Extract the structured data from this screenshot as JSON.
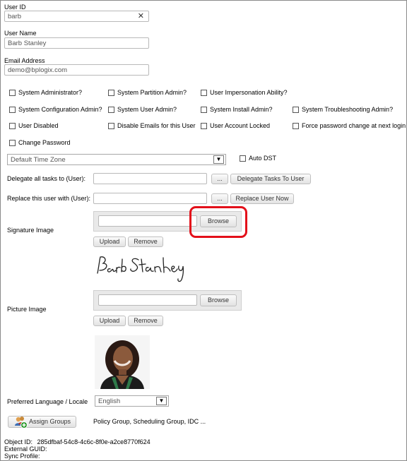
{
  "user_id": {
    "label": "User ID",
    "value": "barb"
  },
  "user_name": {
    "label": "User Name",
    "value": "Barb Stanley"
  },
  "email": {
    "label": "Email Address",
    "value": "demo@bplogix.com"
  },
  "checkboxes": {
    "sys_admin": "System Administrator?",
    "partition_admin": "System Partition Admin?",
    "impersonation": "User Impersonation Ability?",
    "config_admin": "System Configuration Admin?",
    "user_admin": "System User Admin?",
    "install_admin": "System Install Admin?",
    "troubleshooting_admin": "System Troubleshooting Admin?",
    "user_disabled": "User Disabled",
    "disable_emails": "Disable Emails for this User",
    "account_locked": "User Account Locked",
    "force_password": "Force password change at next login",
    "change_password": "Change Password"
  },
  "time_zone": {
    "value": "Default Time Zone",
    "auto_dst_label": "Auto DST"
  },
  "delegate": {
    "label": "Delegate all tasks to (User):",
    "dots": "...",
    "button": "Delegate Tasks To User"
  },
  "replace": {
    "label": "Replace this user with (User):",
    "dots": "...",
    "button": "Replace User Now"
  },
  "signature": {
    "label": "Signature Image",
    "browse": "Browse",
    "upload": "Upload",
    "remove": "Remove",
    "signature_text": "Barb Stanley"
  },
  "picture": {
    "label": "Picture Image",
    "browse": "Browse",
    "upload": "Upload",
    "remove": "Remove"
  },
  "language": {
    "label": "Preferred Language / Locale",
    "value": "English"
  },
  "groups": {
    "button": "Assign Groups",
    "value": "Policy Group, Scheduling Group, IDC ..."
  },
  "footer": {
    "object_id_label": "Object ID:",
    "object_id_value": "285dfbaf-54c8-4c6c-8f0e-a2ce8770f624",
    "external_guid_label": "External GUID:",
    "sync_profile_label": "Sync Profile:"
  },
  "colors": {
    "highlight": "#e3101a",
    "panel": "#e9e9e9"
  }
}
